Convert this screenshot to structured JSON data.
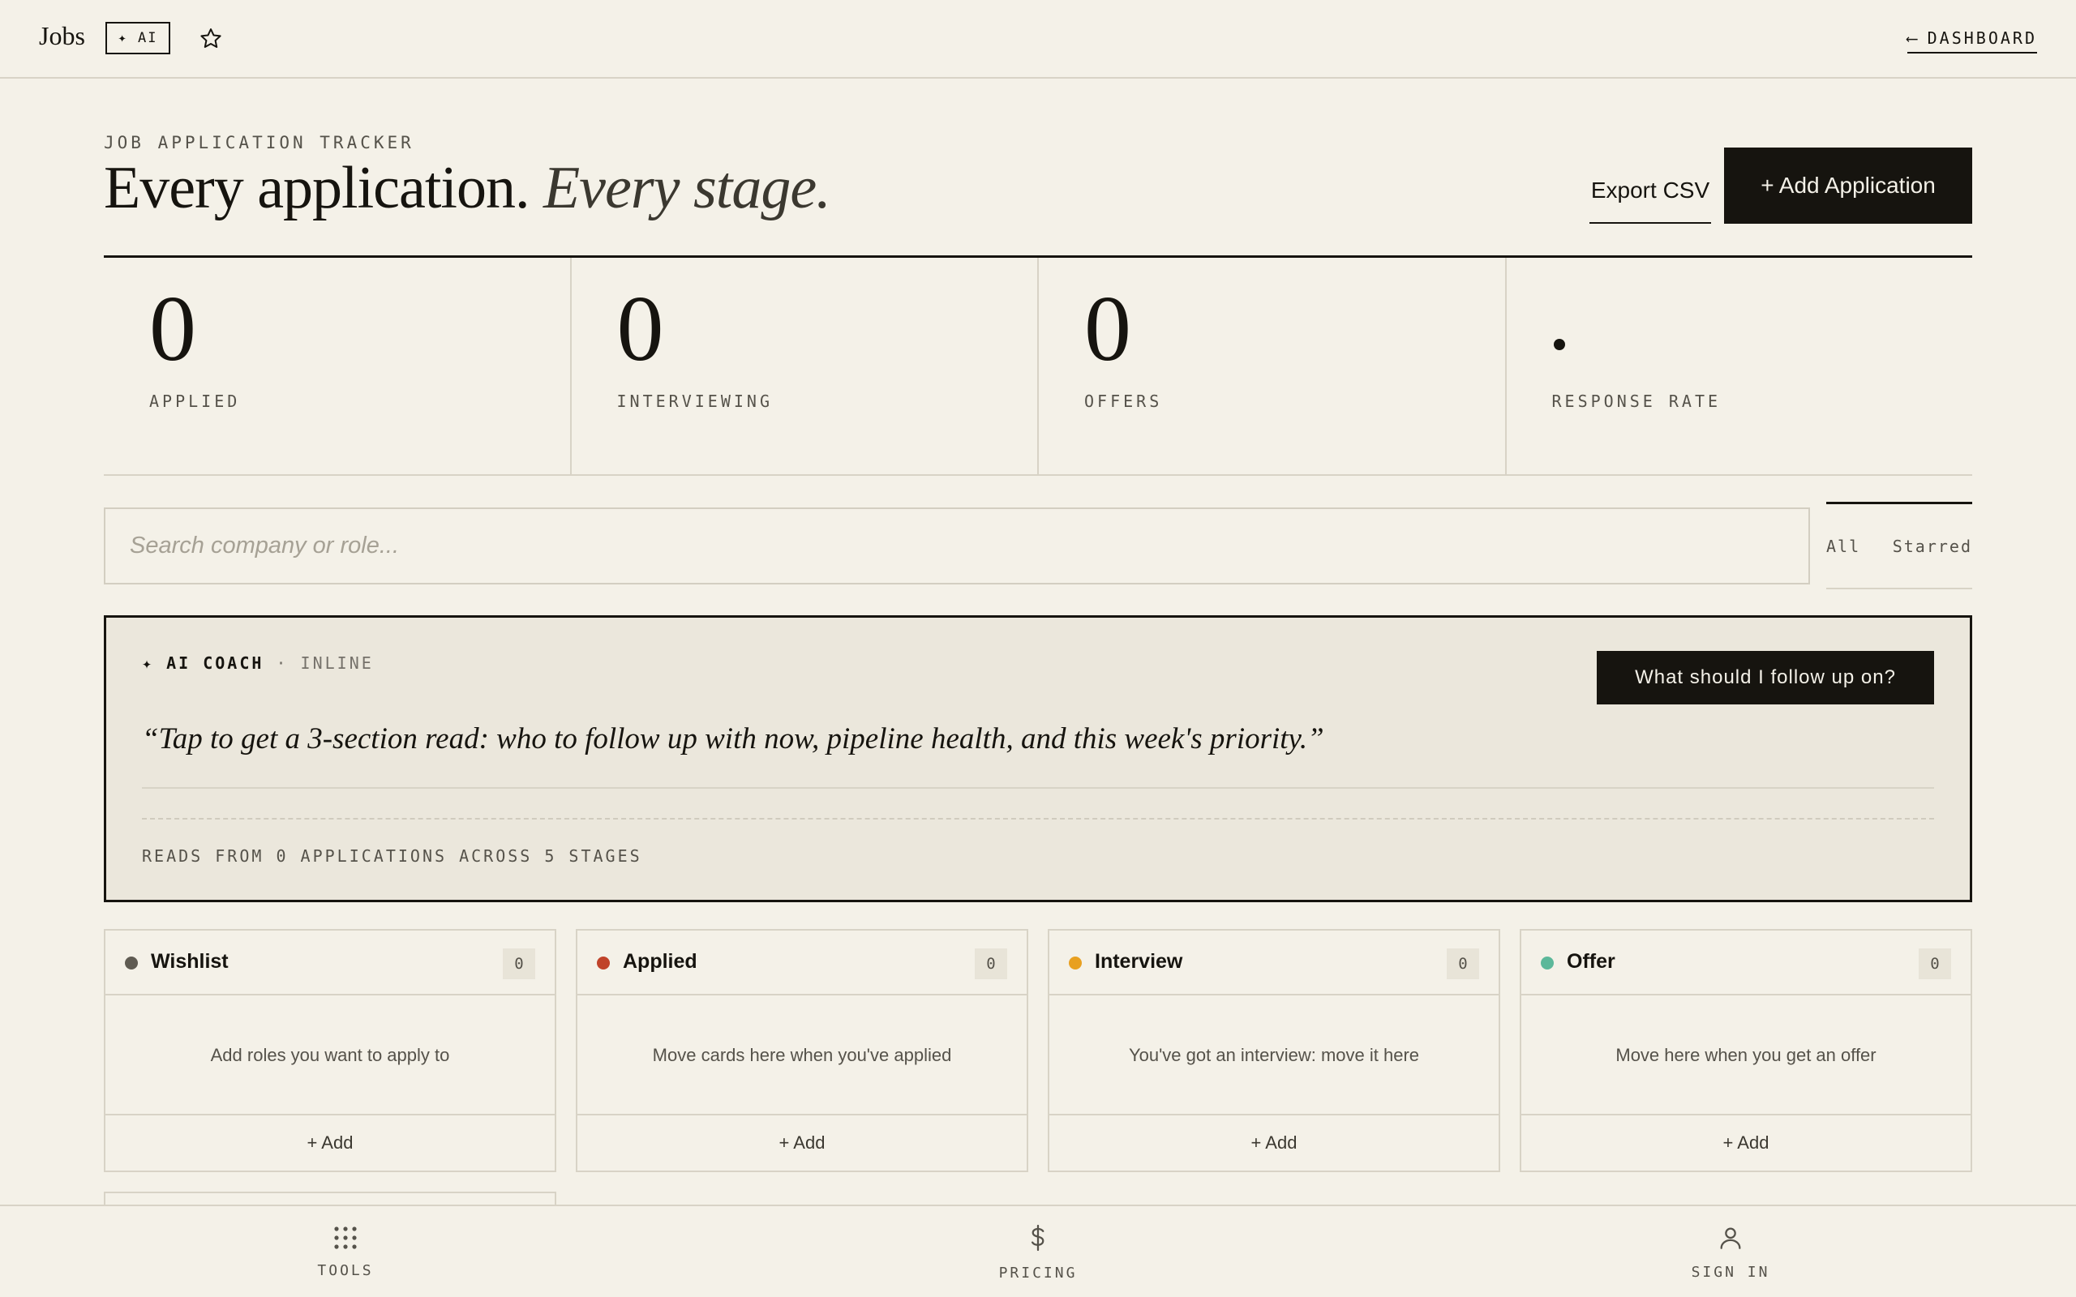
{
  "topbar": {
    "brand": "Jobs",
    "ai_badge": "✦ AI",
    "star_icon": "star-icon",
    "dashboard_link": "DASHBOARD",
    "back_arrow": "⟵"
  },
  "header": {
    "eyebrow": "JOB APPLICATION TRACKER",
    "title_main": "Every application.",
    "title_italic": "Every stage.",
    "export_label": "Export CSV",
    "add_label": "+ Add Application"
  },
  "stats": [
    {
      "value": "0",
      "label": "APPLIED"
    },
    {
      "value": "0",
      "label": "INTERVIEWING"
    },
    {
      "value": "0",
      "label": "OFFERS"
    },
    {
      "value": "",
      "label": "RESPONSE RATE"
    }
  ],
  "search": {
    "placeholder": "Search company or role..."
  },
  "filters": {
    "all": "All",
    "starred": "Starred"
  },
  "coach": {
    "tag_strong": "✦ AI COACH",
    "tag_rest": "· INLINE",
    "button": "What should I follow up on?",
    "quote": "“Tap to get a 3-section read: who to follow up with now, pipeline health, and this week's priority.”",
    "footer": "READS FROM 0 APPLICATIONS ACROSS 5 STAGES"
  },
  "columns": [
    {
      "title": "Wishlist",
      "count": "0",
      "empty": "Add roles you want to apply to",
      "add": "+ Add",
      "color": "#5f5b52"
    },
    {
      "title": "Applied",
      "count": "0",
      "empty": "Move cards here when you've applied",
      "add": "+ Add",
      "color": "#c0432a"
    },
    {
      "title": "Interview",
      "count": "0",
      "empty": "You've got an interview: move it here",
      "add": "+ Add",
      "color": "#e8a020"
    },
    {
      "title": "Offer",
      "count": "0",
      "empty": "Move here when you get an offer",
      "add": "+ Add",
      "color": "#5cb89a"
    }
  ],
  "bottomnav": [
    {
      "label": "TOOLS",
      "icon": "grid-icon"
    },
    {
      "label": "PRICING",
      "icon": "dollar-icon"
    },
    {
      "label": "SIGN IN",
      "icon": "user-icon"
    }
  ]
}
